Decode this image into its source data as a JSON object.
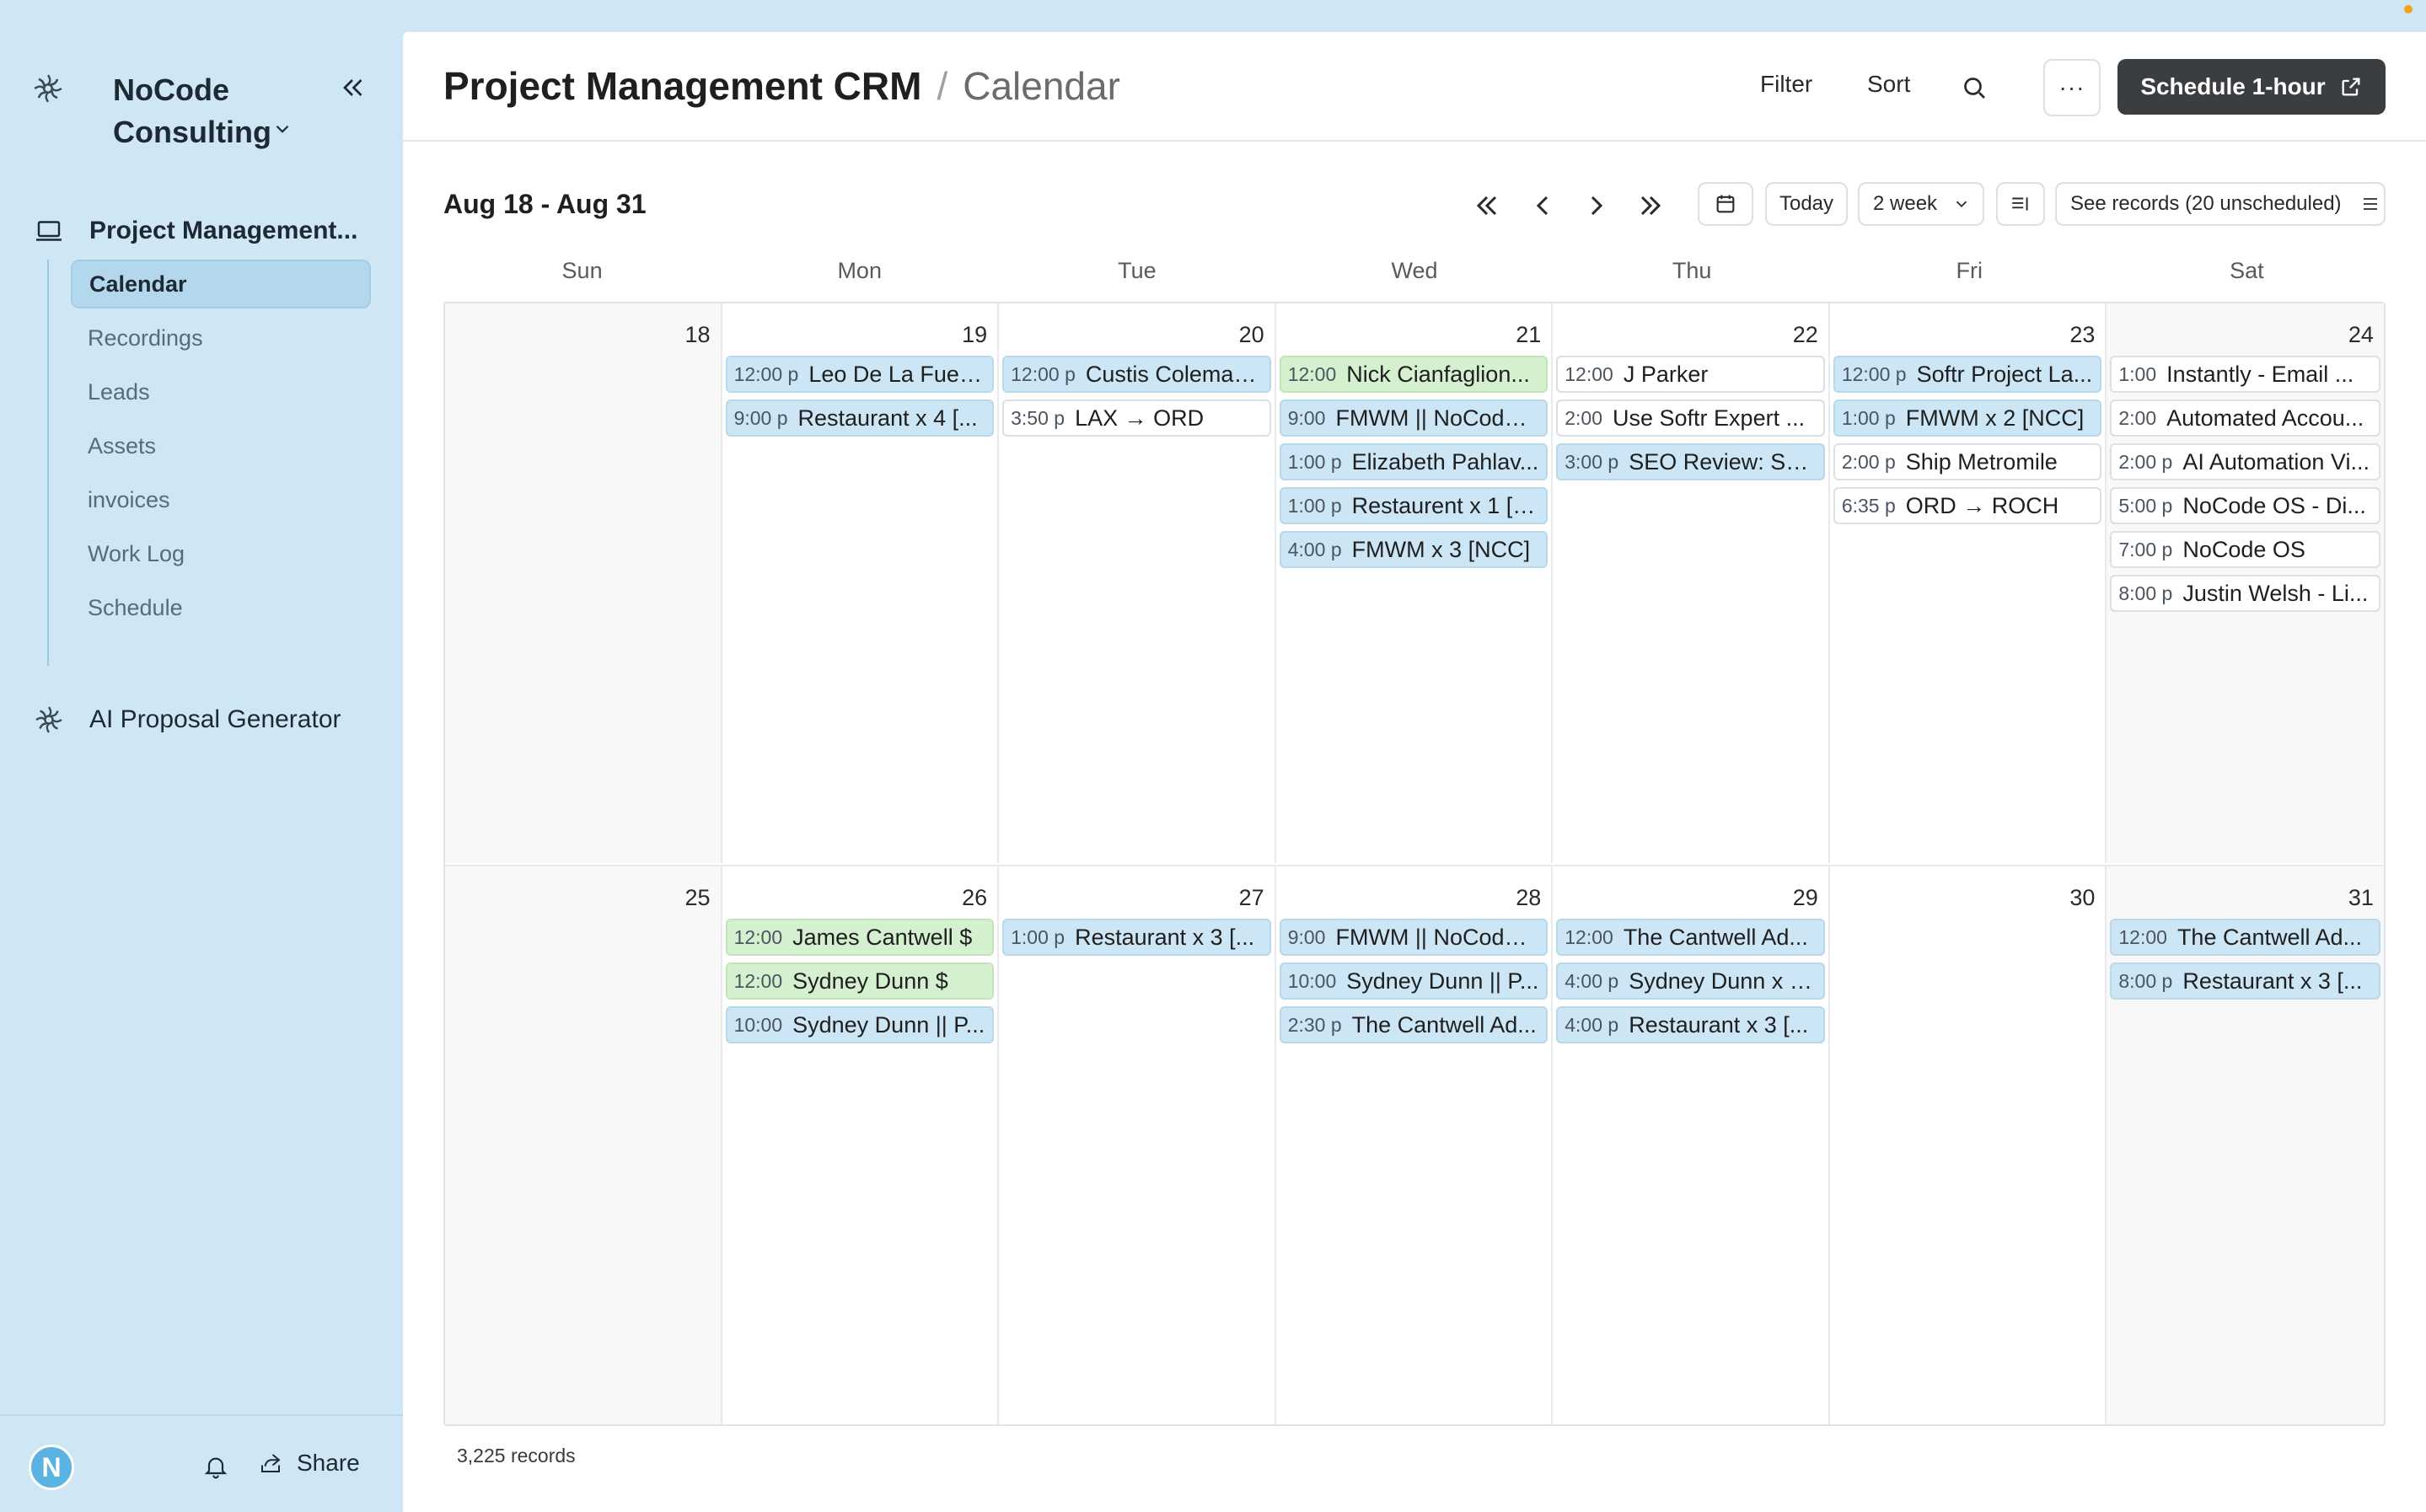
{
  "sidebar": {
    "workspace_name": "NoCode Consulting",
    "group_title": "Project Management...",
    "items": [
      {
        "label": "Calendar",
        "active": true
      },
      {
        "label": "Recordings",
        "active": false
      },
      {
        "label": "Leads",
        "active": false
      },
      {
        "label": "Assets",
        "active": false
      },
      {
        "label": "invoices",
        "active": false
      },
      {
        "label": "Work Log",
        "active": false
      },
      {
        "label": "Schedule",
        "active": false
      }
    ],
    "second_group_title": "AI Proposal Generator",
    "avatar_letter": "N",
    "share_label": "Share"
  },
  "header": {
    "title": "Project Management CRM",
    "separator": "/",
    "subtitle": "Calendar",
    "filter_label": "Filter",
    "sort_label": "Sort",
    "more_label": "···",
    "primary_label": "Schedule 1-hour"
  },
  "toolbar": {
    "range": "Aug 18 - Aug 31",
    "today_label": "Today",
    "view_label": "2 week",
    "see_records_label": "See records (20 unscheduled)"
  },
  "weekdays": [
    "Sun",
    "Mon",
    "Tue",
    "Wed",
    "Thu",
    "Fri",
    "Sat"
  ],
  "weeks": [
    {
      "days": [
        {
          "num": "18",
          "events": []
        },
        {
          "num": "19",
          "events": [
            {
              "time": "12:00 p",
              "name": "Leo De La Fuent...",
              "color": "blue"
            },
            {
              "time": "9:00 p",
              "name": "Restaurant x 4 [...",
              "color": "blue"
            }
          ]
        },
        {
          "num": "20",
          "events": [
            {
              "time": "12:00 p",
              "name": "Custis Coleman ...",
              "color": "blue"
            },
            {
              "time": "3:50 p",
              "name": "LAX → ORD",
              "color": "white"
            }
          ]
        },
        {
          "num": "21",
          "events": [
            {
              "time": "12:00",
              "name": "Nick Cianfaglion...",
              "color": "green"
            },
            {
              "time": "9:00",
              "name": "FMWM || NoCode ...",
              "color": "blue"
            },
            {
              "time": "1:00 p",
              "name": "Elizabeth Pahlav...",
              "color": "blue"
            },
            {
              "time": "1:00 p",
              "name": "Restaurent x 1 [N...",
              "color": "blue"
            },
            {
              "time": "4:00 p",
              "name": "FMWM x 3 [NCC]",
              "color": "blue"
            }
          ]
        },
        {
          "num": "22",
          "events": [
            {
              "time": "12:00",
              "name": "J Parker",
              "color": "white"
            },
            {
              "time": "2:00",
              "name": "Use Softr Expert ...",
              "color": "white"
            },
            {
              "time": "3:00 p",
              "name": "SEO Review: Sof...",
              "color": "blue"
            }
          ]
        },
        {
          "num": "23",
          "events": [
            {
              "time": "12:00 p",
              "name": "Softr Project La...",
              "color": "blue"
            },
            {
              "time": "1:00 p",
              "name": "FMWM x 2 [NCC]",
              "color": "blue"
            },
            {
              "time": "2:00 p",
              "name": "Ship Metromile",
              "color": "white"
            },
            {
              "time": "6:35 p",
              "name": "ORD → ROCH",
              "color": "white"
            }
          ]
        },
        {
          "num": "24",
          "events": [
            {
              "time": "1:00",
              "name": "Instantly - Email ...",
              "color": "white"
            },
            {
              "time": "2:00",
              "name": "Automated Accou...",
              "color": "white"
            },
            {
              "time": "2:00 p",
              "name": "AI Automation Vi...",
              "color": "white"
            },
            {
              "time": "5:00 p",
              "name": "NoCode OS - Di...",
              "color": "white"
            },
            {
              "time": "7:00 p",
              "name": "NoCode OS",
              "color": "white"
            },
            {
              "time": "8:00 p",
              "name": "Justin Welsh - Li...",
              "color": "white"
            }
          ]
        }
      ]
    },
    {
      "days": [
        {
          "num": "25",
          "events": []
        },
        {
          "num": "26",
          "events": [
            {
              "time": "12:00",
              "name": "James Cantwell $",
              "color": "green"
            },
            {
              "time": "12:00",
              "name": "Sydney Dunn $",
              "color": "green"
            },
            {
              "time": "10:00",
              "name": "Sydney Dunn || P...",
              "color": "blue"
            }
          ]
        },
        {
          "num": "27",
          "events": [
            {
              "time": "1:00 p",
              "name": "Restaurant x 3 [...",
              "color": "blue"
            }
          ]
        },
        {
          "num": "28",
          "events": [
            {
              "time": "9:00",
              "name": "FMWM || NoCode ...",
              "color": "blue"
            },
            {
              "time": "10:00",
              "name": "Sydney Dunn || P...",
              "color": "blue"
            },
            {
              "time": "2:30 p",
              "name": "The Cantwell Ad...",
              "color": "blue"
            }
          ]
        },
        {
          "num": "29",
          "events": [
            {
              "time": "12:00",
              "name": "The Cantwell Ad...",
              "color": "blue"
            },
            {
              "time": "4:00 p",
              "name": "Sydney Dunn x 3...",
              "color": "blue"
            },
            {
              "time": "4:00 p",
              "name": "Restaurant x 3 [...",
              "color": "blue"
            }
          ]
        },
        {
          "num": "30",
          "events": []
        },
        {
          "num": "31",
          "events": [
            {
              "time": "12:00",
              "name": "The Cantwell Ad...",
              "color": "blue"
            },
            {
              "time": "8:00 p",
              "name": "Restaurant x 3 [...",
              "color": "blue"
            }
          ]
        }
      ]
    }
  ],
  "footer": {
    "records_count": "3,225 records"
  }
}
